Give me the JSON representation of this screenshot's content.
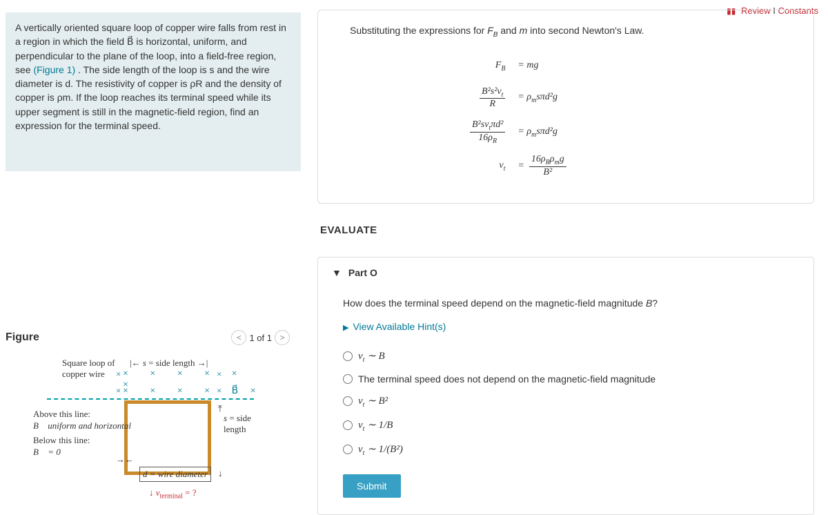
{
  "topLinks": {
    "review": "Review",
    "constants": "Constants"
  },
  "problem": {
    "text_before_link": "A vertically oriented square loop of copper wire falls from rest in a region in which the field B⃗ is horizontal, uniform, and perpendicular to the plane of the loop, into a field-free region, see ",
    "figure_link": "(Figure 1)",
    "text_after_link": ". The side length of the loop is s and the wire diameter is d. The resistivity of copper is ρR and the density of copper is ρm. If the loop reaches its terminal speed while its upper segment is still in the magnetic-field region, find an expression for the terminal speed."
  },
  "figure": {
    "title": "Figure",
    "pager": "1 of 1",
    "labels": {
      "loop_label": "Square loop of copper wire",
      "s_side_length": "s = side length",
      "s_side": "s = side length",
      "above_line": "Above this line:",
      "b_uniform": "B⃗ uniform and horizontal",
      "below_line": "Below this line:",
      "b_zero": "B⃗ = 0",
      "d_wire": "d = wire diameter",
      "v_terminal": "v_terminal = ?"
    }
  },
  "derivation": {
    "intro": "Substituting the expressions for F_B and m into second Newton's Law.",
    "rows": [
      {
        "lhs": "F_B",
        "rhs": "= mg"
      },
      {
        "lhs": "B²s²v_t / R",
        "rhs": "= ρ_m sπd² g"
      },
      {
        "lhs": "B²sv_t πd² / 16ρ_R",
        "rhs": "= ρ_m sπd² g"
      },
      {
        "lhs": "v_t",
        "rhs": "= 16ρ_R ρ_m g / B²"
      }
    ]
  },
  "evaluate_label": "EVALUATE",
  "part": {
    "label": "Part O",
    "question": "How does the terminal speed depend on the magnetic-field magnitude B?",
    "hints_label": "View Available Hint(s)",
    "choices": [
      "v_t ∼ B",
      "The terminal speed does not depend on the magnetic-field magnitude",
      "v_t ∼ B²",
      "v_t ∼ 1/B",
      "v_t ∼ 1/(B²)"
    ],
    "submit": "Submit"
  }
}
